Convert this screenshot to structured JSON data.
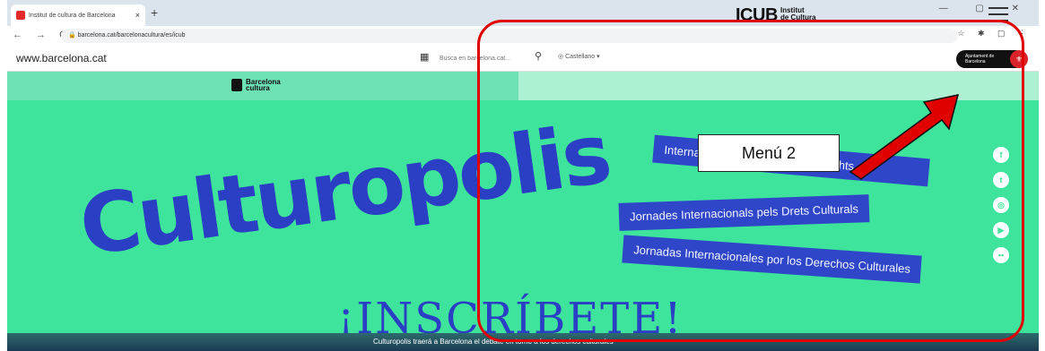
{
  "browser": {
    "tab_title": "Institut de cultura de Barcelona",
    "tab_close": "×",
    "new_tab": "+",
    "nav_buttons": "← → C",
    "url": "barcelona.cat/barcelonacultura/es/icub"
  },
  "site_header": {
    "domain": "www.barcelona.cat",
    "search_placeholder": "Busca en barcelona.cat...",
    "language": "Castellano",
    "ajuntament_line1": "Ajuntament de",
    "ajuntament_line2": "Barcelona"
  },
  "brand_bar": {
    "left_logo_line1": "Barcelona",
    "left_logo_line2": "cultura",
    "icub": "ICUB",
    "icub_sub_line1": "Institut",
    "icub_sub_line2": "de Cultura"
  },
  "hero": {
    "headline": "Culturopolis",
    "pill1": "International Days for Cultural Rights",
    "pill2": "Jornades Internacionals pels Drets Culturals",
    "pill3": "Jornadas Internacionales por los Derechos Culturales",
    "cta": "¡INSCRÍBETE!",
    "footer_text": "Culturopolis traerá a Barcelona el debate en torno a los derechos culturales"
  },
  "social_icons": [
    "facebook-icon",
    "twitter-icon",
    "instagram-icon",
    "youtube-icon",
    "flickr-icon"
  ],
  "annotation": {
    "label": "Menú 2",
    "color": "#e00000"
  },
  "colors": {
    "hero_green": "#3ee49b",
    "pill_blue": "#2f46c9",
    "headline_blue": "#2b3fc4"
  }
}
